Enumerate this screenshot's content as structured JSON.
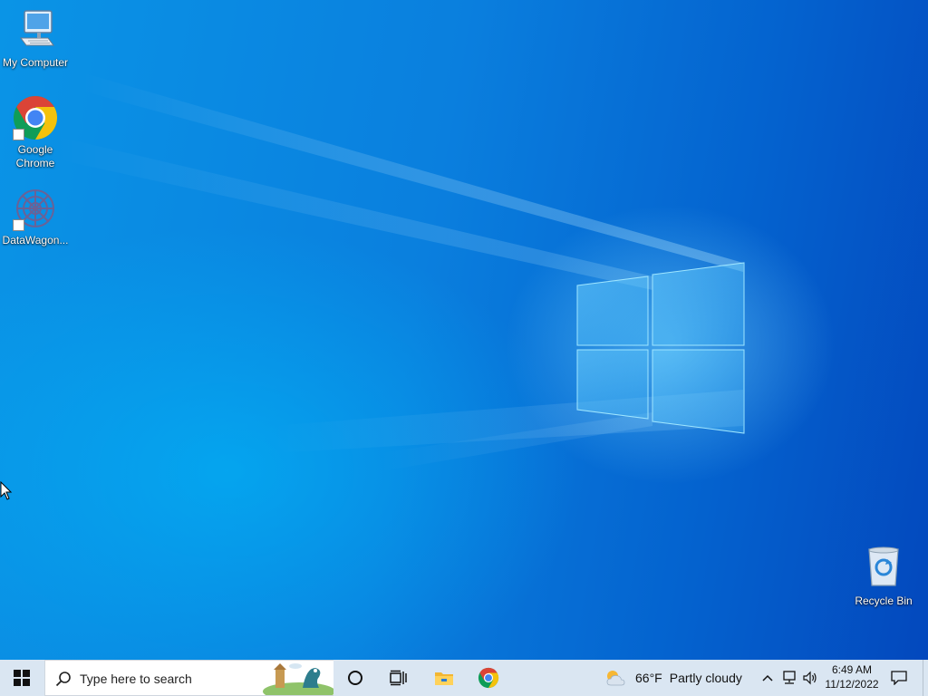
{
  "desktop": {
    "icons": [
      {
        "label": "My Computer",
        "icon": "monitor-icon"
      },
      {
        "label": "Google\nChrome",
        "icon": "chrome-icon"
      },
      {
        "label": "DataWagon...",
        "icon": "datawagon-icon"
      },
      {
        "label": "Recycle Bin",
        "icon": "recycle-bin-icon"
      }
    ]
  },
  "taskbar": {
    "search_placeholder": "Type here to search",
    "weather": {
      "temp": "66°F",
      "condition": "Partly cloudy"
    },
    "clock": {
      "time": "6:49 AM",
      "date": "11/12/2022"
    }
  },
  "colors": {
    "taskbar_bg": "#dae6f2",
    "desktop_light": "#0aa0ee",
    "desktop_dark": "#0348bd",
    "chrome_red": "#db4437",
    "chrome_yellow": "#f4c20d",
    "chrome_green": "#0f9d58",
    "chrome_blue": "#4285f4"
  }
}
